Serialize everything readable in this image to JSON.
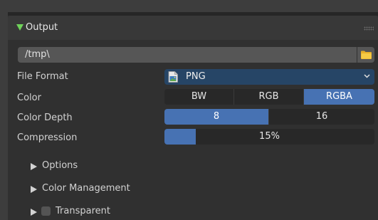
{
  "panel": {
    "title": "Output",
    "expanded": true,
    "header_icon": "triangle-down-icon"
  },
  "output_path": {
    "value": "/tmp\\",
    "browse_icon": "folder-icon"
  },
  "file_format": {
    "label": "File Format",
    "value": "PNG",
    "icon": "png-file-icon"
  },
  "color": {
    "label": "Color",
    "options": [
      "BW",
      "RGB",
      "RGBA"
    ],
    "selected": "RGBA"
  },
  "color_depth": {
    "label": "Color Depth",
    "options": [
      "8",
      "16"
    ],
    "selected": "8"
  },
  "compression": {
    "label": "Compression",
    "display": "15%",
    "value": 0.15
  },
  "subpanels": {
    "options": "Options",
    "color_management": "Color Management",
    "transparent": "Transparent",
    "transparent_checked": false
  },
  "colors": {
    "accent": "#4772b3",
    "enum_bg": "#264566",
    "expand_arrow": "#6fd25a"
  }
}
